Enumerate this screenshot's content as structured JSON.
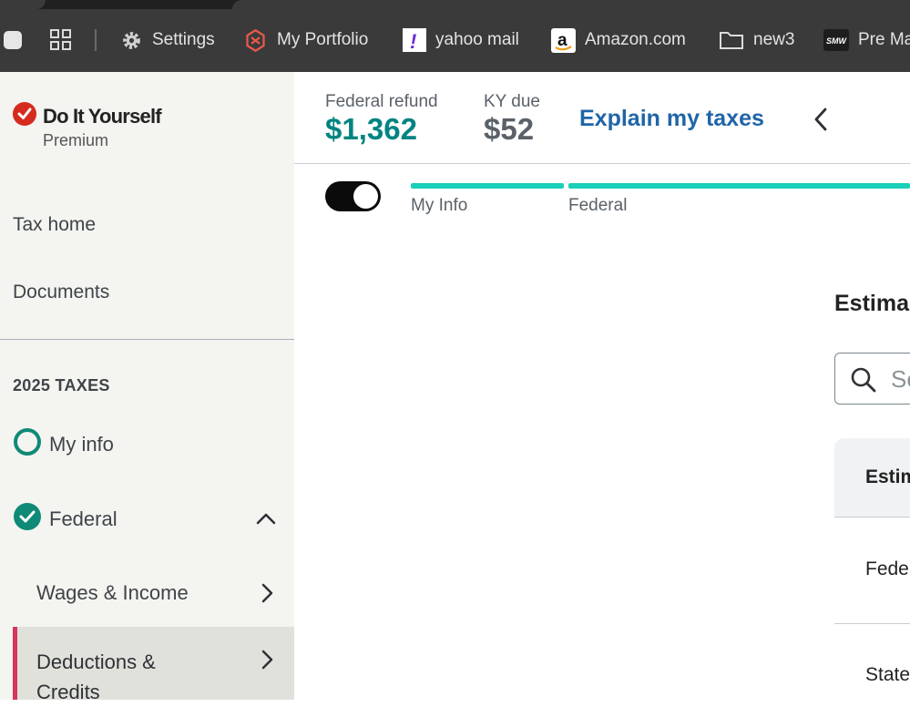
{
  "bookmarks": [
    {
      "icon": "gear-icon",
      "label": "Settings"
    },
    {
      "icon": "portfolio-logo-icon",
      "label": "My Portfolio"
    },
    {
      "icon": "yahoo-icon",
      "label": "yahoo mail"
    },
    {
      "icon": "amazon-icon",
      "label": "Amazon.com"
    },
    {
      "icon": "folder-icon",
      "label": "new3"
    },
    {
      "icon": "smw-icon",
      "label": "Pre Ma"
    }
  ],
  "brand": {
    "title": "Do It Yourself",
    "subtitle": "Premium",
    "smw_logo_text": "SMW",
    "amazon_logo_text": "a",
    "yahoo_logo_text": "!"
  },
  "sidebar": {
    "links": [
      "Tax home",
      "Documents"
    ],
    "section_heading": "2025 TAXES",
    "my_info": "My info",
    "federal": "Federal",
    "wages_income": "Wages & Income",
    "deductions_credits": "Deductions & Credits"
  },
  "header": {
    "refund_label": "Federal refund",
    "refund_value": "$1,362",
    "due_label": "KY due",
    "due_value": "$52",
    "explain_link": "Explain my taxes"
  },
  "progress": {
    "steps": [
      "My Info",
      "Federal"
    ]
  },
  "content": {
    "title": "Estima",
    "search_placeholder": "Se",
    "table_header": "Estim",
    "rows": [
      "Fede",
      "State"
    ]
  },
  "colors": {
    "refund_green": "#008481",
    "link_blue": "#1f65a8",
    "progress_teal": "#19d0b8",
    "active_accent": "#d4365c",
    "sidebar_bg": "#f4f4f1"
  }
}
